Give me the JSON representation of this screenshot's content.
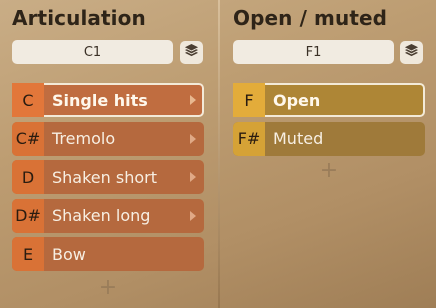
{
  "articulation": {
    "title": "Articulation",
    "key_field": "C1",
    "items": [
      {
        "note": "C",
        "label": "Single hits",
        "selected": true,
        "has_arrow": true
      },
      {
        "note": "C#",
        "label": "Tremolo",
        "selected": false,
        "has_arrow": true
      },
      {
        "note": "D",
        "label": "Shaken short",
        "selected": false,
        "has_arrow": true
      },
      {
        "note": "D#",
        "label": "Shaken long",
        "selected": false,
        "has_arrow": true
      },
      {
        "note": "E",
        "label": "Bow",
        "selected": false,
        "has_arrow": false
      }
    ],
    "add_label": "+"
  },
  "open_muted": {
    "title": "Open / muted",
    "key_field": "F1",
    "items": [
      {
        "note": "F",
        "label": "Open",
        "selected": true
      },
      {
        "note": "F#",
        "label": "Muted",
        "selected": false
      }
    ],
    "add_label": "+"
  },
  "icons": {
    "layers": "layers-icon",
    "arrow": "chevron-right-icon"
  },
  "colors": {
    "orange_accent": "#d97236",
    "gold_accent": "#d5a236",
    "selected_outline": "#f3ead8"
  }
}
